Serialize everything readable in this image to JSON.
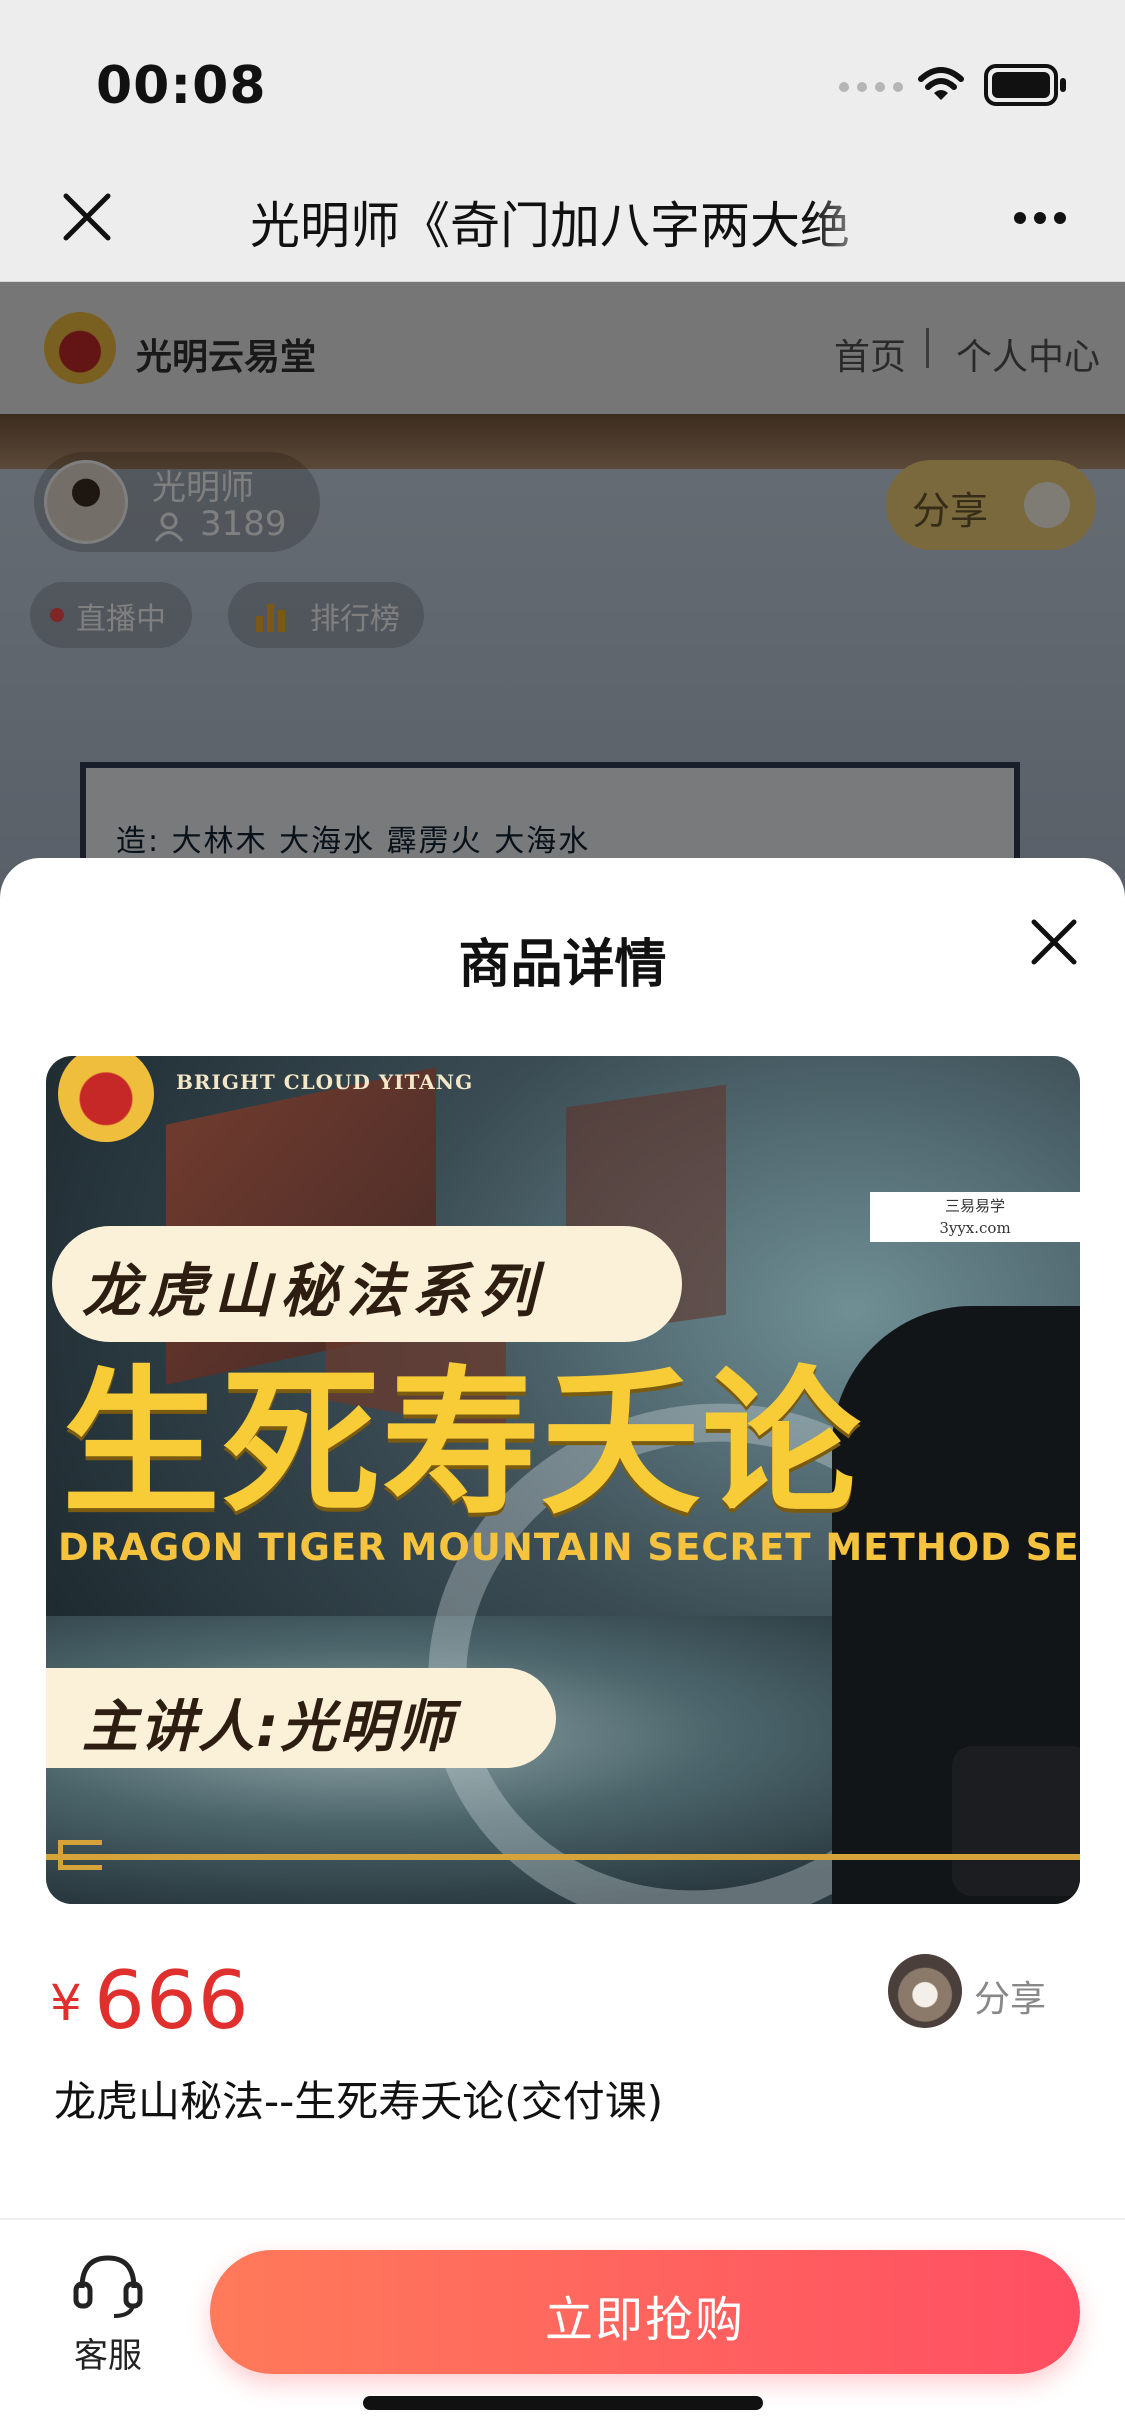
{
  "status_bar": {
    "time": "00:08"
  },
  "nav": {
    "title": "光明师《奇门加八字两大绝",
    "close_icon": "close-icon",
    "more_icon": "more-icon"
  },
  "live_page": {
    "brand": "光明云易堂",
    "home_link": "首页",
    "user_center_link": "个人中心",
    "host_name": "光明师",
    "viewer_count": "3189",
    "share_label": "分享",
    "live_badge": "直播中",
    "rank_label": "排行榜",
    "board_text": "造:  大林木      大海水      霹雳火      大海水"
  },
  "sheet": {
    "title": "商品详情",
    "banner": {
      "brand_en": "BRIGHT CLOUD YITANG",
      "watermark_line1": "三易易学",
      "watermark_line2": "3yyx.com",
      "series": "龙虎山秘法系列",
      "main_title": "生死寿夭论",
      "subtitle_en": "DRAGON TIGER MOUNTAIN SECRET METHOD SERIES",
      "lecturer": "主讲人:光明师"
    },
    "price_symbol": "¥",
    "price": "666",
    "share_label": "分享",
    "product_name": "龙虎山秘法--生死寿夭论(交付课)"
  },
  "bottom_bar": {
    "customer_service": "客服",
    "buy_button": "立即抢购"
  },
  "colors": {
    "price": "#e0302d",
    "buy_gradient_start": "#ff7a5a",
    "buy_gradient_end": "#ff4e63",
    "banner_gold": "#f7cc37"
  }
}
